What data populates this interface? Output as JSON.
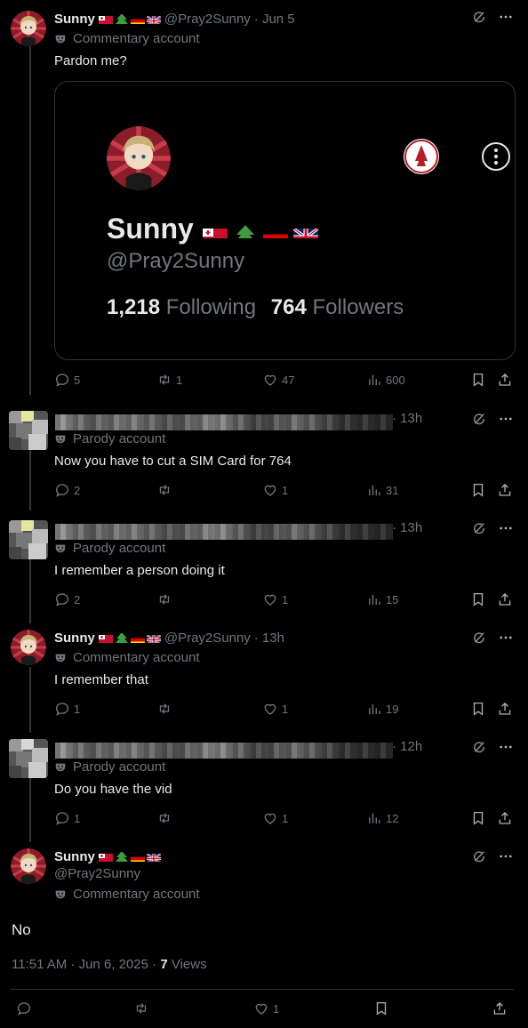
{
  "tweets": [
    {
      "name": "Sunny",
      "handle": "@Pray2Sunny",
      "time": "· Jun 5",
      "badge": "Commentary account",
      "text": "Pardon me?",
      "card": {
        "name": "Sunny",
        "handle": "@Pray2Sunny",
        "following_count": "1,218",
        "following_label": "Following",
        "followers_count": "764",
        "followers_label": "Followers"
      },
      "replies": "5",
      "retweets": "1",
      "likes": "47",
      "views": "600"
    },
    {
      "time": "· 13h",
      "badge": "Parody account",
      "text": "Now you have to cut a SIM Card for 764",
      "replies": "2",
      "retweets": "",
      "likes": "1",
      "views": "31"
    },
    {
      "time": "· 13h",
      "badge": "Parody account",
      "text": "I remember a person doing it",
      "replies": "2",
      "retweets": "",
      "likes": "1",
      "views": "15"
    },
    {
      "name": "Sunny",
      "handle": "@Pray2Sunny",
      "time": "· 13h",
      "badge": "Commentary account",
      "text": "I remember that",
      "replies": "1",
      "retweets": "",
      "likes": "1",
      "views": "19"
    },
    {
      "time": "· 12h",
      "badge": "Parody account",
      "text": "Do you have the vid",
      "replies": "1",
      "retweets": "",
      "likes": "1",
      "views": "12"
    }
  ],
  "main": {
    "name": "Sunny",
    "handle": "@Pray2Sunny",
    "badge": "Commentary account",
    "text": "No",
    "timestamp": "11:51 AM · Jun 6, 2025 · ",
    "views_count": "7",
    "views_label": " Views",
    "likes": "1"
  },
  "icons": {
    "flags": [
      "tonga-flag-icon",
      "tree-icon",
      "germany-flag-icon",
      "uk-flag-icon"
    ],
    "actions": [
      "reply-icon",
      "retweet-icon",
      "like-icon",
      "views-icon",
      "bookmark-icon",
      "share-icon"
    ]
  },
  "colors": {
    "background": "#000000",
    "text": "#e7e9ea",
    "muted": "#71767b",
    "border": "#2f3336"
  }
}
